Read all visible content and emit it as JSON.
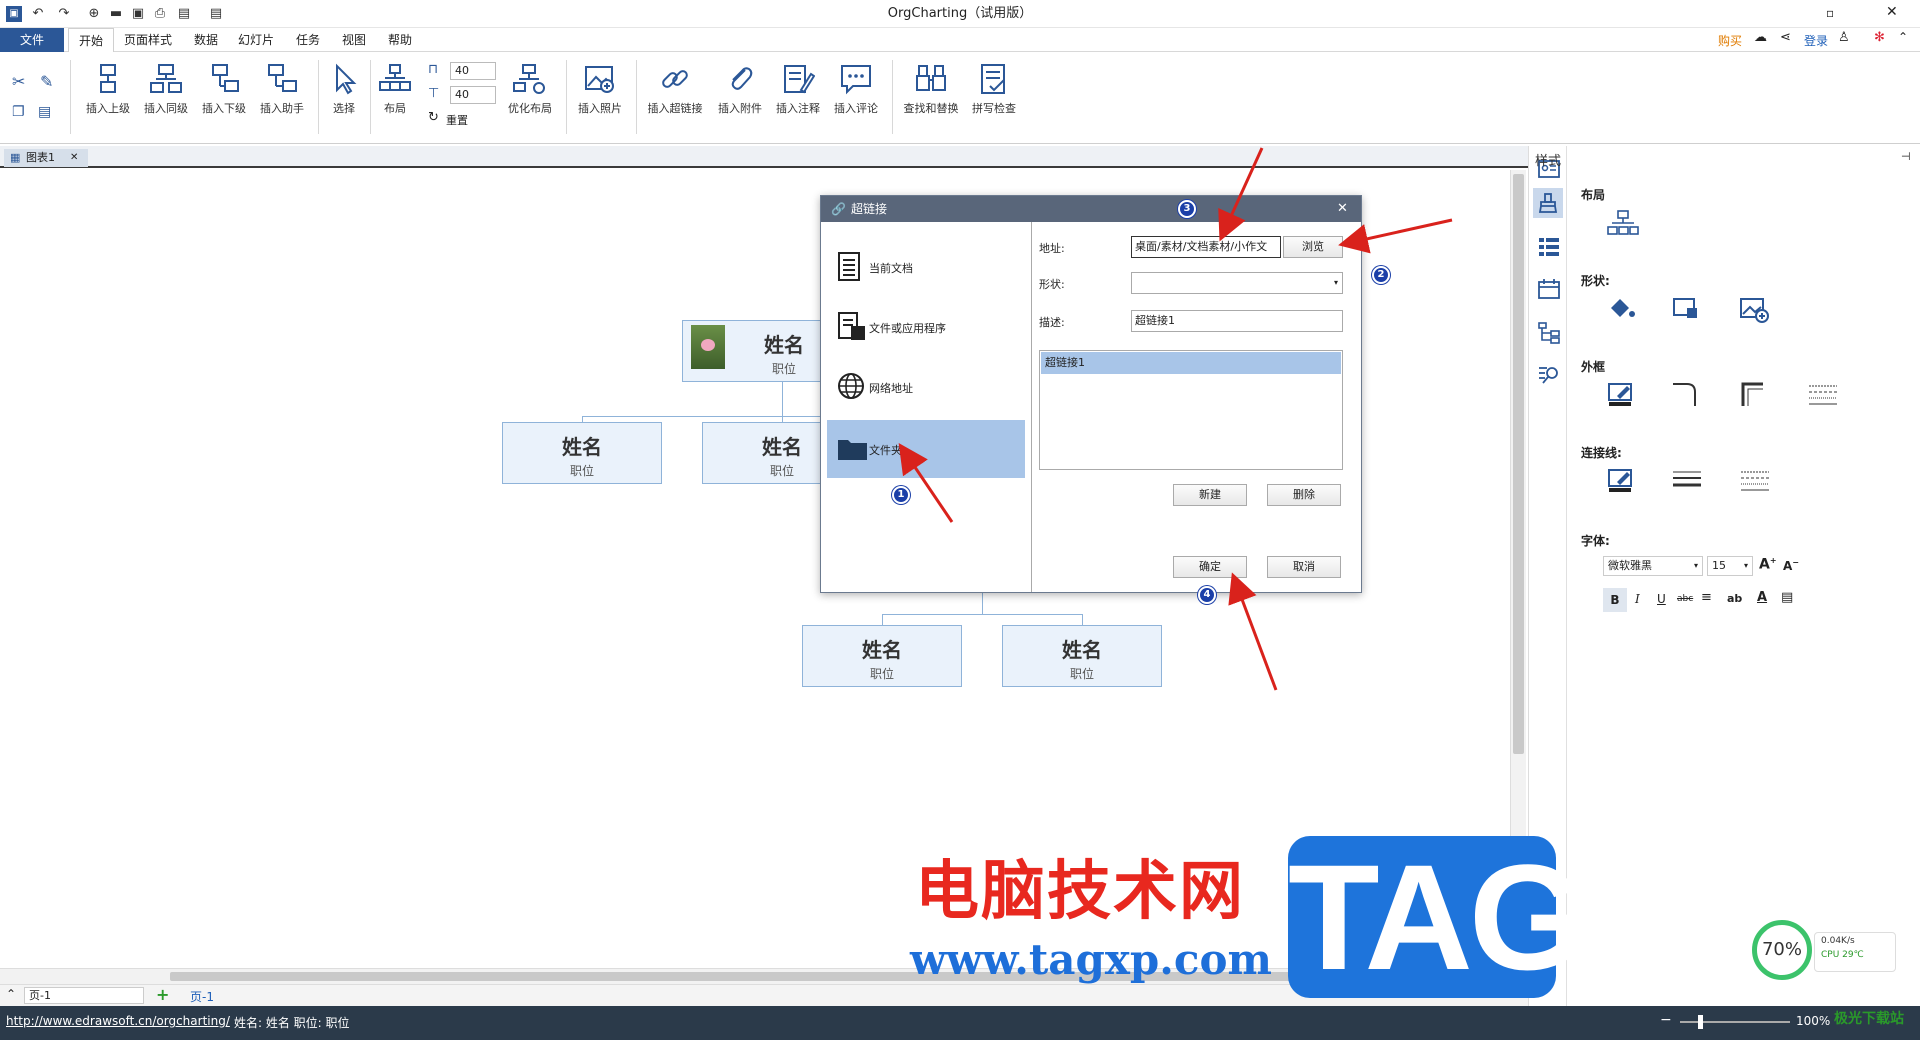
{
  "app": {
    "title": "OrgCharting（试用版）"
  },
  "titlebar_right": {
    "buy": "购买",
    "login": "登录"
  },
  "menu": [
    "文件",
    "开始",
    "页面样式",
    "数据",
    "幻灯片",
    "任务",
    "视图",
    "帮助"
  ],
  "ribbon": {
    "insert_upper": "插入上级",
    "insert_same": "插入同级",
    "insert_lower": "插入下级",
    "insert_assistant": "插入助手",
    "select": "选择",
    "layout": "布局",
    "spin_w": "40",
    "spin_h": "40",
    "reset": "重置",
    "optimize_layout": "优化布局",
    "insert_photo": "插入照片",
    "insert_hyperlink": "插入超链接",
    "insert_attachment": "插入附件",
    "insert_note": "插入注释",
    "insert_comment": "插入评论",
    "find_replace": "查找和替换",
    "spell_check": "拼写检查"
  },
  "doc_tab": "图表1",
  "org": {
    "top": {
      "name": "姓名",
      "pos": "职位"
    },
    "mid": [
      {
        "name": "姓名",
        "pos": "职位"
      },
      {
        "name": "姓名",
        "pos": "职位"
      }
    ],
    "bottom": [
      {
        "name": "姓名",
        "pos": "职位"
      },
      {
        "name": "姓名",
        "pos": "职位"
      }
    ]
  },
  "dialog": {
    "title": "超链接",
    "left_items": [
      "当前文档",
      "文件或应用程序",
      "网络地址",
      "文件夹"
    ],
    "address_label": "地址:",
    "address_value": "桌面/素材/文档素材/小作文",
    "browse": "浏览",
    "shape_label": "形状:",
    "shape_value": "",
    "desc_label": "描述:",
    "desc_value": "超链接1",
    "list_items": [
      "超链接1"
    ],
    "new": "新建",
    "delete": "删除",
    "ok": "确定",
    "cancel": "取消"
  },
  "badges": [
    "1",
    "2",
    "3",
    "4"
  ],
  "panel": {
    "title": "样式",
    "layout": "布局",
    "shape": "形状:",
    "frame": "外框",
    "connector": "连接线:",
    "font": "字体:",
    "font_name": "微软雅黑",
    "font_size": "15"
  },
  "pagebar": {
    "page_select": "页-1",
    "page_tab": "页-1"
  },
  "status": {
    "url": "http://www.edrawsoft.cn/orgcharting/",
    "info": "姓名: 姓名  职位: 职位",
    "zoom": "100%"
  },
  "watermark": {
    "cn": "电脑技术网",
    "url": "www.tagxp.com",
    "tag": "TAG",
    "site": "极光下载站"
  },
  "perf": {
    "percent": "70%",
    "net": "0.04K/s",
    "cpu": "CPU 29℃"
  },
  "colors": {
    "accent": "#2b5797",
    "selection": "#a8c5e8",
    "arrow": "#d9221c",
    "badge": "#1b3fa8"
  }
}
